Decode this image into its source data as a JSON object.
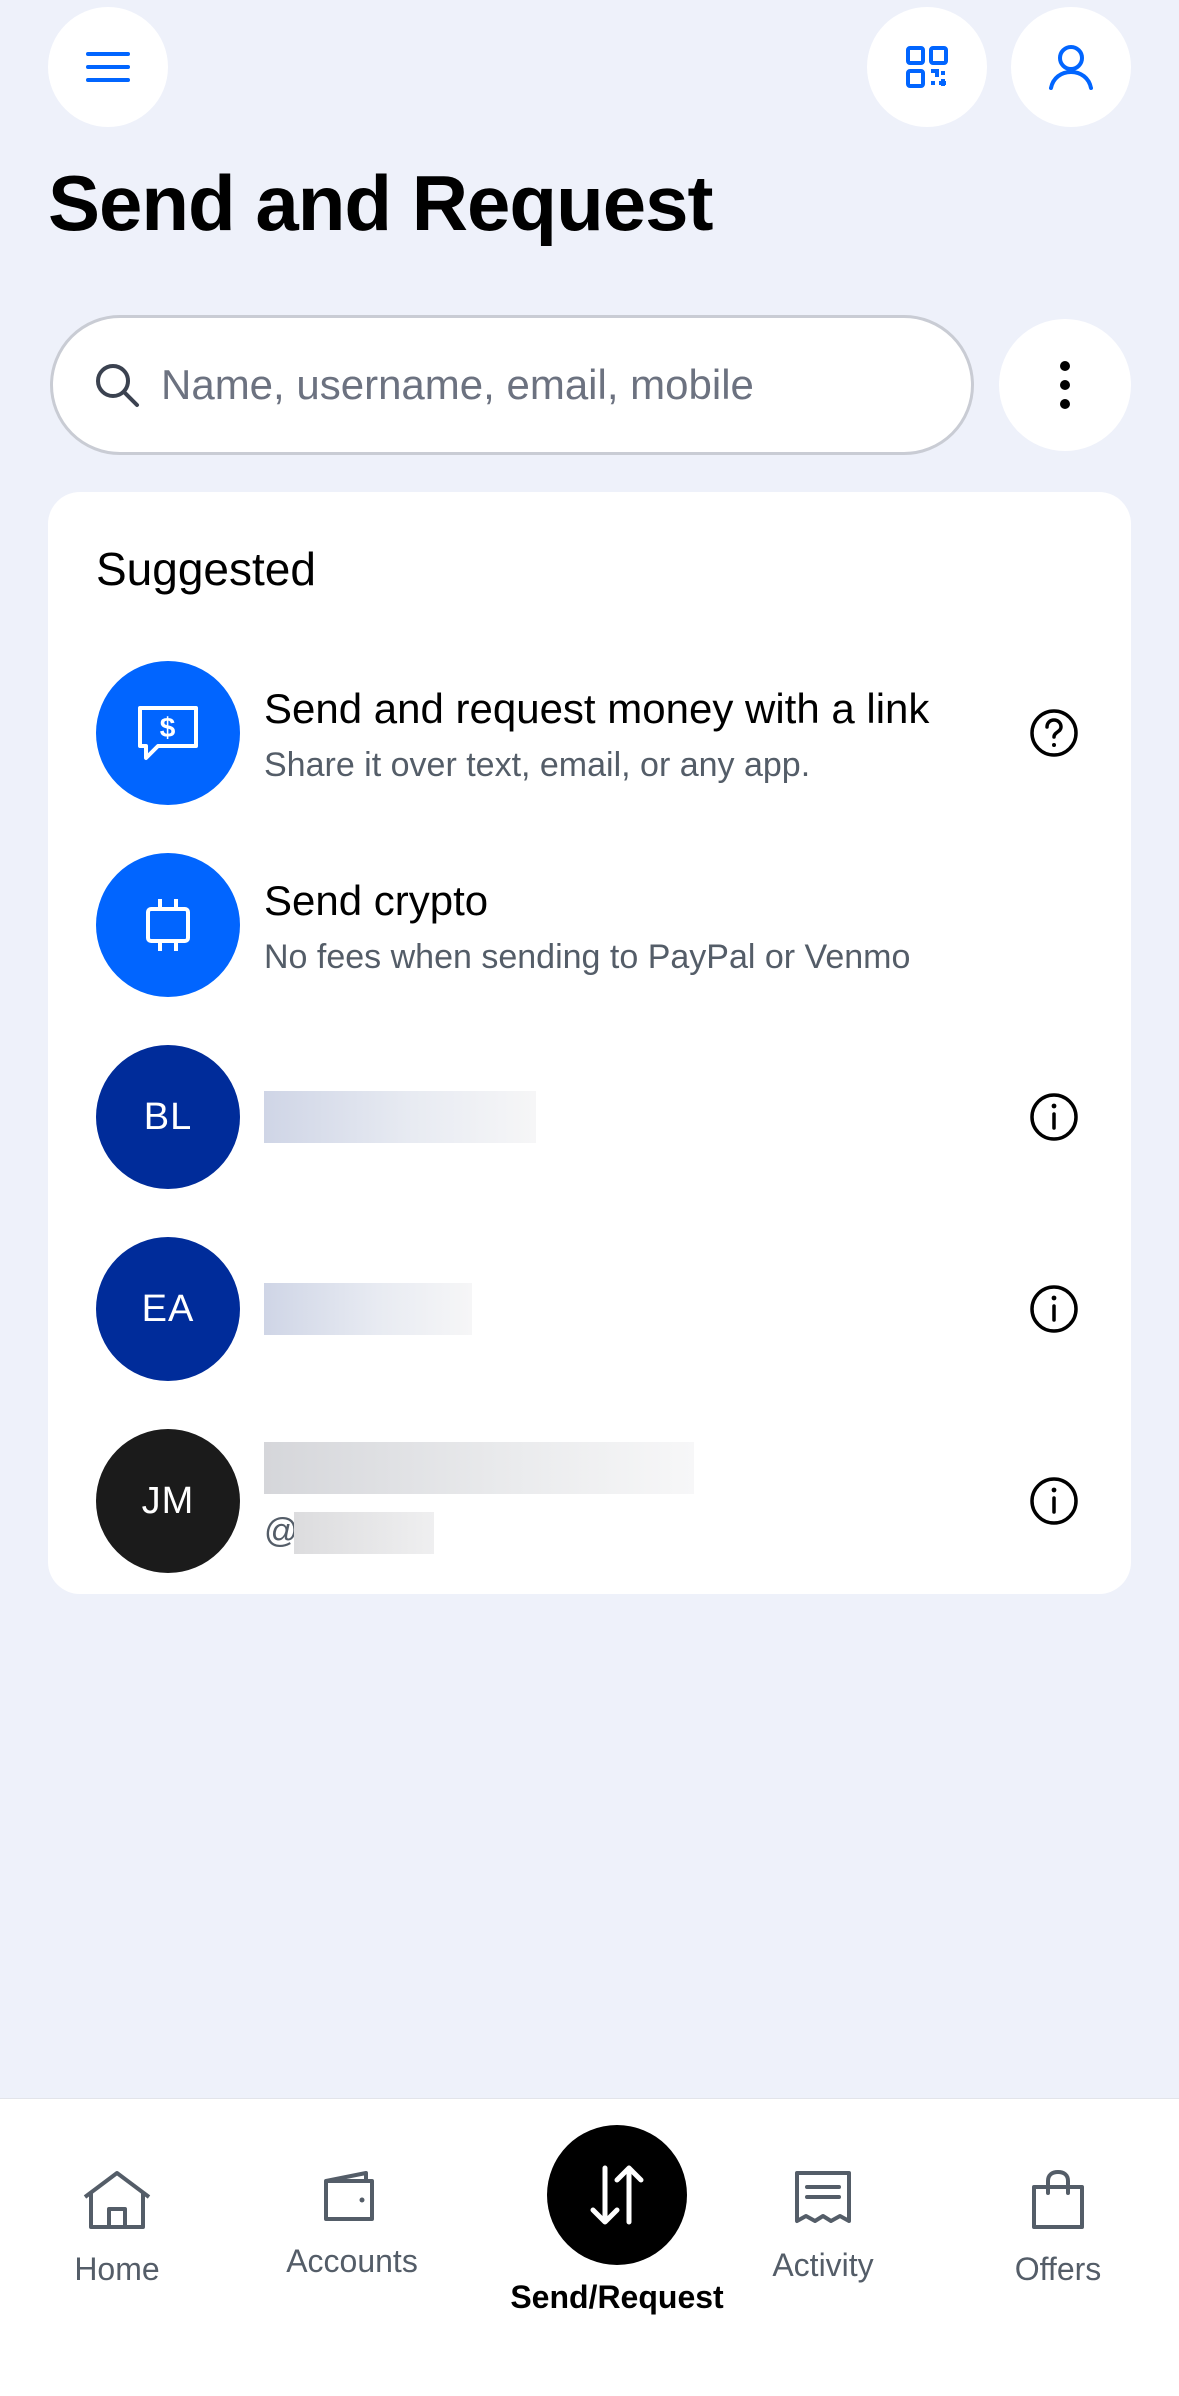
{
  "header": {
    "title": "Send and Request"
  },
  "search": {
    "placeholder": "Name, username, email, mobile",
    "value": ""
  },
  "suggested": {
    "title": "Suggested",
    "items": [
      {
        "title": "Send and request money with a link",
        "subtitle": "Share it over text, email, or any app."
      },
      {
        "title": "Send crypto",
        "subtitle": "No fees when sending to PayPal or Venmo"
      }
    ],
    "contacts": [
      {
        "initials": "BL"
      },
      {
        "initials": "EA"
      },
      {
        "initials": "JM",
        "handle_prefix": "@"
      }
    ]
  },
  "nav": {
    "home": "Home",
    "accounts": "Accounts",
    "send": "Send/Request",
    "activity": "Activity",
    "offers": "Offers"
  },
  "colors": {
    "background": "#eef1fa",
    "primary_blue": "#0165ff",
    "navy": "#002c9a",
    "icon_blue": "#0165ff"
  }
}
